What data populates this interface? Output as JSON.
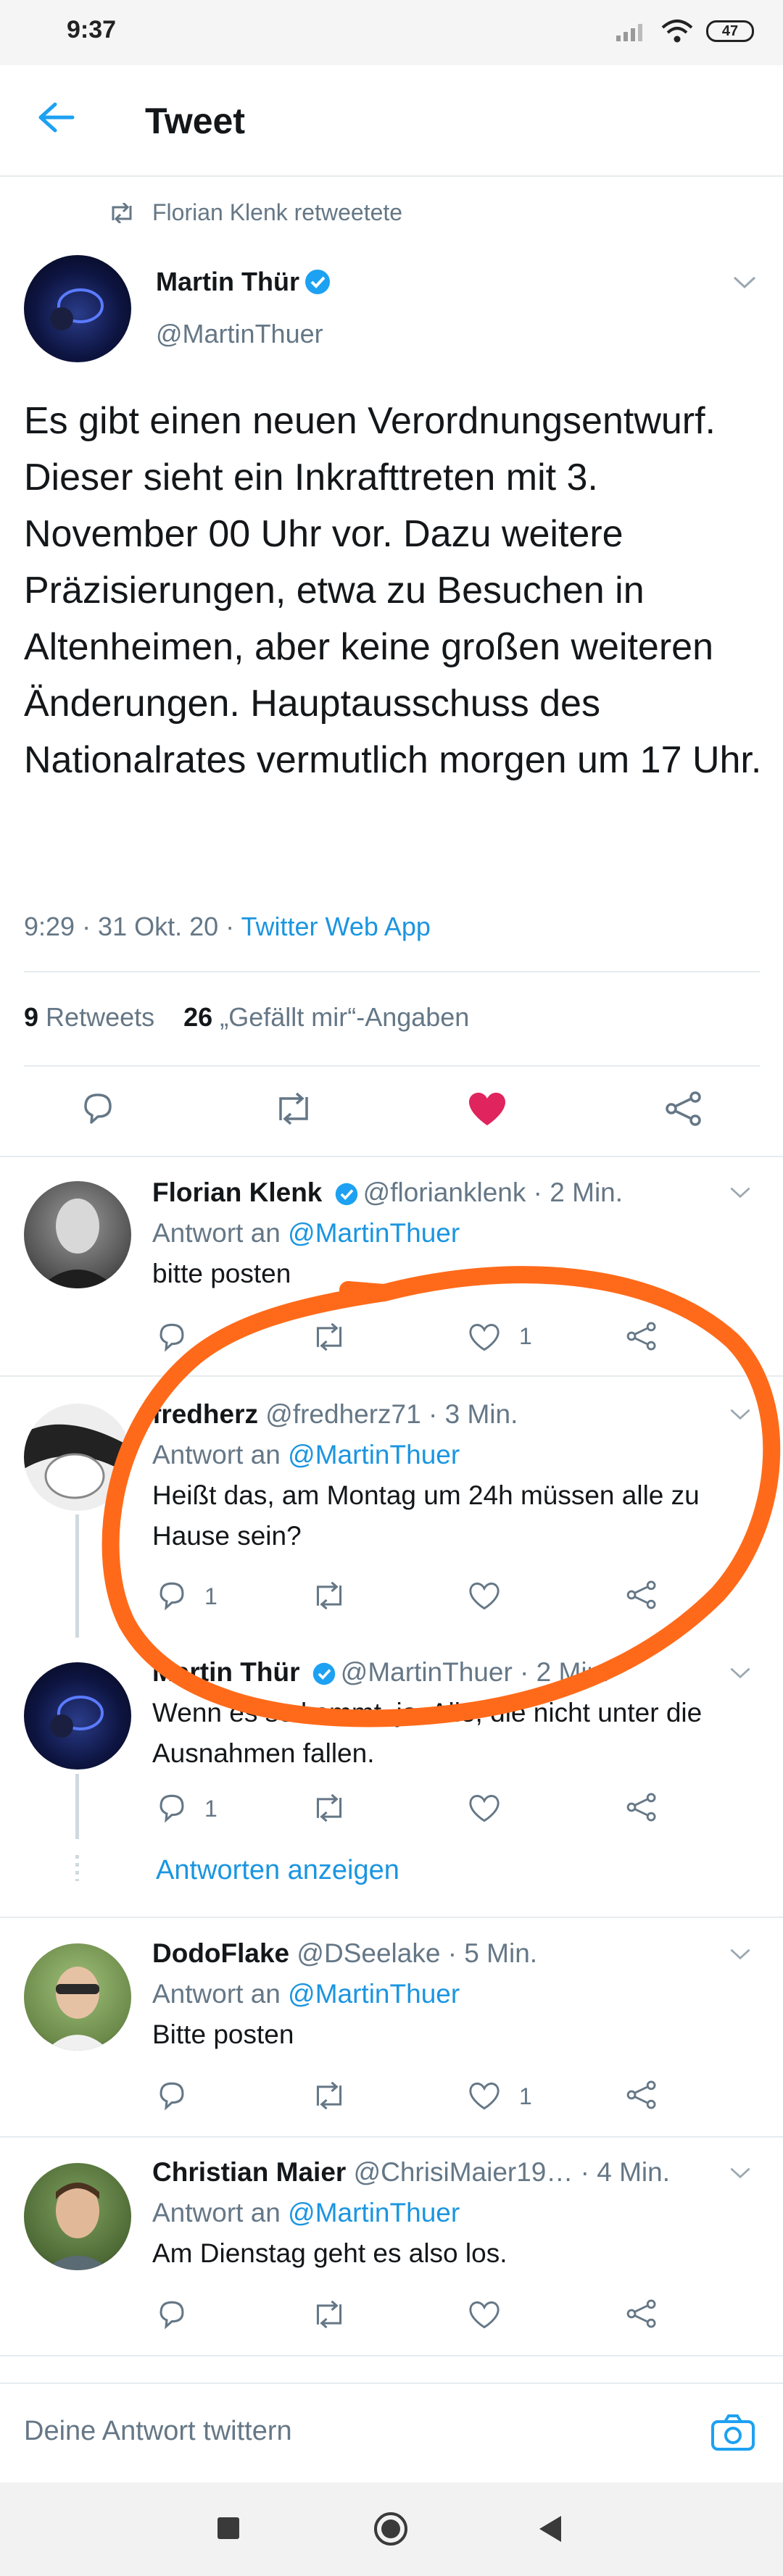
{
  "status_bar": {
    "time": "9:37",
    "battery": "47"
  },
  "header": {
    "title": "Tweet"
  },
  "retweet_context": "Florian Klenk retweetete",
  "main_tweet": {
    "name": "Martin Thür",
    "handle": "@MartinThuer",
    "text": "Es gibt einen neuen Verordnungsentwurf. Dieser sieht ein Inkrafttreten mit 3. November 00 Uhr vor. Dazu weitere Präzisierungen, etwa zu Besuchen in Altenheimen, aber keine großen weiteren Änderungen. Hauptausschuss des Nationalrates vermutlich morgen um 17 Uhr.",
    "meta_time": "9:29 · 31 Okt. 20 · ",
    "source": "Twitter Web App",
    "retweets_count": "9",
    "retweets_label": "Retweets",
    "likes_count": "26",
    "likes_label": "„Gefällt mir“-Angaben"
  },
  "replies": [
    {
      "name": "Florian Klenk",
      "handle": "@florianklenk · 2 Min.",
      "reply_prefix": "Antwort an ",
      "reply_to": "@MartinThuer",
      "text": "bitte posten",
      "like_count": "1",
      "reply_count": ""
    },
    {
      "name": "fredherz",
      "handle": "@fredherz71 · 3 Min.",
      "reply_prefix": "Antwort an ",
      "reply_to": "@MartinThuer",
      "text": "Heißt das, am Montag um 24h müssen alle zu Hause sein?",
      "like_count": "",
      "reply_count": "1"
    },
    {
      "name": "Martin Thür",
      "handle": "@MartinThuer · 2 Min.",
      "text": "Wenn es so kommt, ja. Alle, die nicht unter die Ausnahmen fallen.",
      "like_count": "",
      "reply_count": "1"
    },
    {
      "name": "DodoFlake",
      "handle": "@DSeelake · 5 Min.",
      "reply_prefix": "Antwort an ",
      "reply_to": "@MartinThuer",
      "text": "Bitte posten",
      "like_count": "1",
      "reply_count": ""
    },
    {
      "name": "Christian Maier",
      "handle": "@ChrisiMaier19…",
      "time": "· 4 Min.",
      "reply_prefix": "Antwort an ",
      "reply_to": "@MartinThuer",
      "text": "Am Dienstag geht es also los.",
      "like_count": "",
      "reply_count": ""
    }
  ],
  "show_replies": "Antworten anzeigen",
  "composer": {
    "placeholder": "Deine Antwort twittern"
  },
  "colors": {
    "accent": "#1b95e0",
    "like_red": "#e0245e",
    "annotation_orange": "#ff6a1a"
  }
}
